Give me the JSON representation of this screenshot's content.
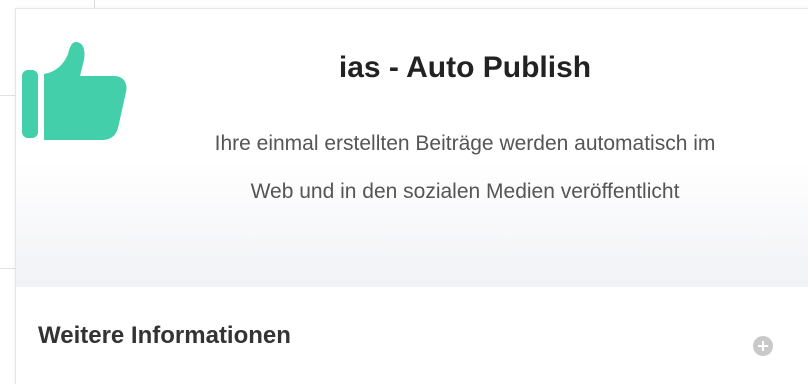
{
  "header": {
    "title": "ias - Auto Publish",
    "description_line1": "Ihre einmal erstellten Beiträge werden automatisch im",
    "description_line2": "Web und in den sozialen Medien veröffentlicht",
    "icon": "thumbs-up-icon",
    "icon_color": "#43cfa9"
  },
  "details": {
    "label": "Weitere Informationen",
    "expand_icon": "plus-circle-icon",
    "expand_icon_color": "#c9c9c9"
  }
}
